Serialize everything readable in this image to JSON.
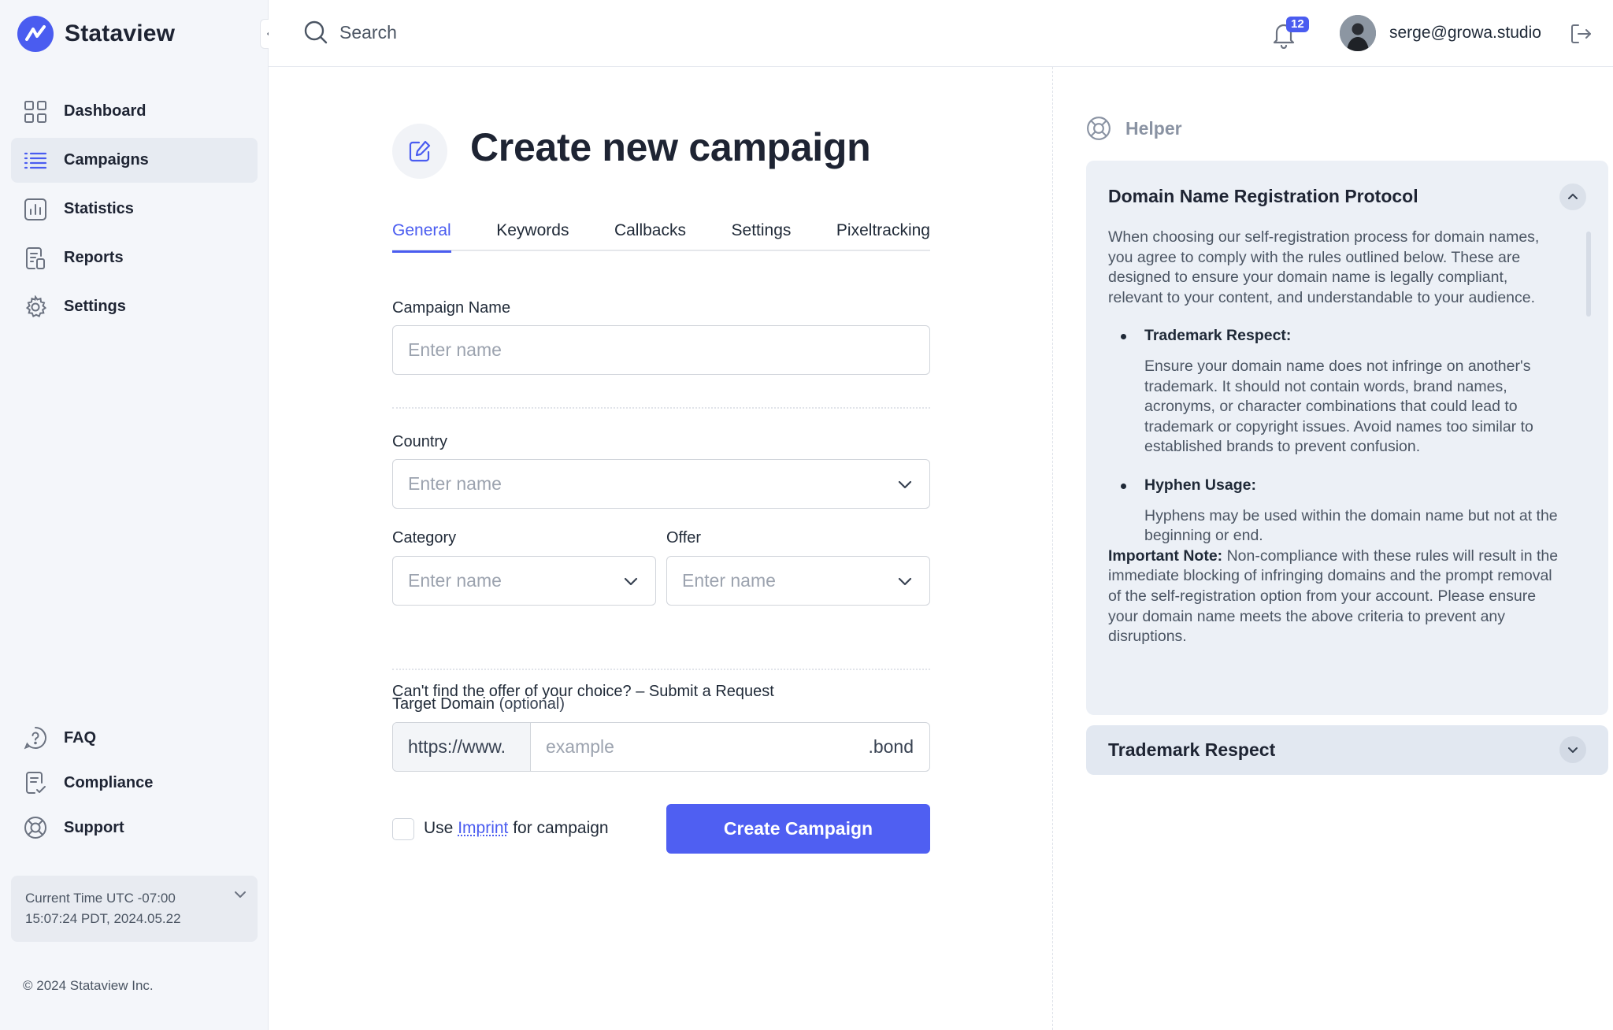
{
  "brand": {
    "name": "Stataview"
  },
  "sidebar": {
    "items": [
      {
        "label": "Dashboard",
        "icon": "grid-icon"
      },
      {
        "label": "Campaigns",
        "icon": "list-icon",
        "active": true
      },
      {
        "label": "Statistics",
        "icon": "chart-icon"
      },
      {
        "label": "Reports",
        "icon": "report-icon"
      },
      {
        "label": "Settings",
        "icon": "gear-icon"
      }
    ],
    "bottom_items": [
      {
        "label": "FAQ",
        "icon": "help-icon"
      },
      {
        "label": "Compliance",
        "icon": "document-check-icon"
      },
      {
        "label": "Support",
        "icon": "lifebuoy-icon"
      }
    ],
    "time": {
      "line1": "Current Time UTC -07:00",
      "line2": "15:07:24 PDT, 2024.05.22"
    },
    "copyright": "© 2024 Stataview Inc."
  },
  "header": {
    "search_placeholder": "Search",
    "notifications_count": "12",
    "user_email": "serge@growa.studio"
  },
  "main": {
    "title": "Create new campaign",
    "tabs": [
      {
        "label": "General",
        "active": true
      },
      {
        "label": "Keywords"
      },
      {
        "label": "Callbacks"
      },
      {
        "label": "Settings"
      },
      {
        "label": "Pixeltracking"
      }
    ],
    "campaign_name": {
      "label": "Campaign Name",
      "placeholder": "Enter name"
    },
    "country": {
      "label": "Country",
      "placeholder": "Enter name"
    },
    "category": {
      "label": "Category",
      "placeholder": "Enter name"
    },
    "offer": {
      "label": "Offer",
      "placeholder": "Enter name"
    },
    "offer_hint": {
      "text": "Can't find the offer of your choice? – ",
      "link": "Submit a Request"
    },
    "target_domain": {
      "label": "Target Domain",
      "label_suffix": "(optional)",
      "prefix": "https://www.",
      "placeholder": "example",
      "suffix": ".bond"
    },
    "imprint": {
      "before": "Use ",
      "link": "Imprint",
      "after": " for campaign"
    },
    "create_button": "Create Campaign"
  },
  "helper": {
    "title": "Helper",
    "accordion_open": {
      "title": "Domain Name Registration Protocol",
      "intro": "When choosing our self-registration process for domain names, you agree to comply with the rules outlined below. These are designed to ensure your domain name is legally compliant, relevant to your content, and understandable to your audience.",
      "bullets": [
        {
          "title": "Trademark Respect:",
          "text": "Ensure your domain name does not infringe on another's trademark. It should not contain words, brand names, acronyms, or character combinations that could lead to trademark or copyright issues. Avoid names too similar to established brands to prevent confusion."
        },
        {
          "title": "Hyphen Usage:",
          "text": "Hyphens may be used within the domain name but not at the beginning or end."
        }
      ],
      "note_label": "Important Note:",
      "note_text": " Non-compliance with these rules will result in the immediate blocking of infringing domains and the prompt removal of the self-registration option from your account. Please ensure your domain name meets the above criteria to prevent any disruptions."
    },
    "accordion_closed": {
      "title": "Trademark Respect"
    }
  },
  "colors": {
    "accent": "#4a5cf0",
    "sidebar_bg": "#f4f6fa",
    "active_item_bg": "#e7ebf2",
    "helper_panel_bg": "#ecf0f6"
  }
}
